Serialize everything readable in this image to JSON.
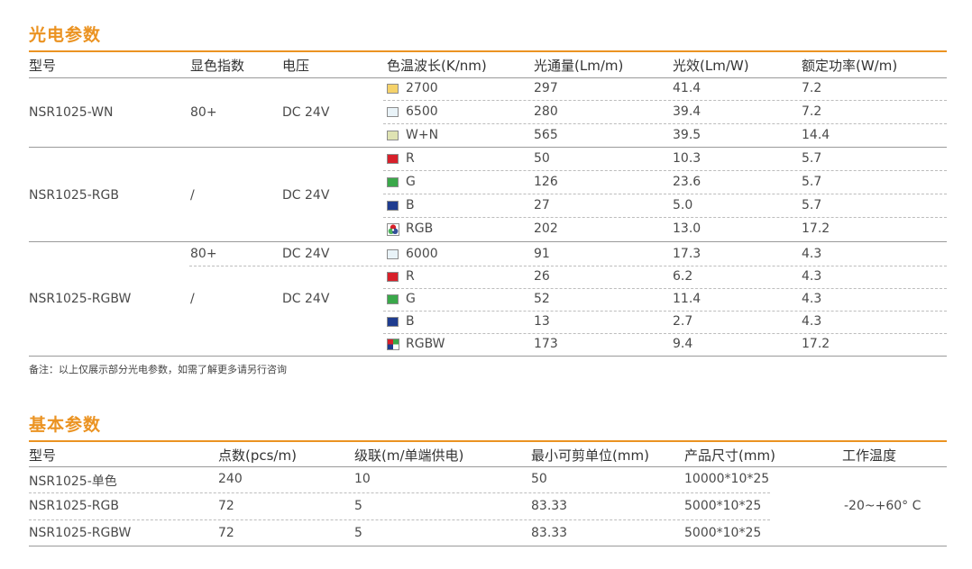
{
  "photo_section": {
    "title": "光电参数",
    "headers": [
      "型号",
      "显色指数",
      "电压",
      "色温波长(K/nm)",
      "光通量(Lm/m)",
      "光效(Lm/W)",
      "额定功率(W/m)"
    ],
    "groups": [
      {
        "model": "NSR1025-WN",
        "cri": "80+",
        "voltage": "DC 24V"
      },
      {
        "model": "NSR1025-RGB",
        "cri": "/",
        "voltage": "DC 24V"
      },
      {
        "model": "NSR1025-RGBW",
        "cri_a": "80+",
        "voltage_a": "DC 24V",
        "cri_b": "/",
        "voltage_b": "DC 24V"
      }
    ],
    "rows": [
      {
        "swatch": "#f5d26a",
        "ct": "2700",
        "flux": "297",
        "eff": "41.4",
        "power": "7.2"
      },
      {
        "swatch": "#e9f3f8",
        "ct": "6500",
        "flux": "280",
        "eff": "39.4",
        "power": "7.2"
      },
      {
        "swatch": "#dfe3b3",
        "ct": "W+N",
        "flux": "565",
        "eff": "39.5",
        "power": "14.4"
      },
      {
        "swatch": "#d7202a",
        "ct": "R",
        "flux": "50",
        "eff": "10.3",
        "power": "5.7"
      },
      {
        "swatch": "#3aa84a",
        "ct": "G",
        "flux": "126",
        "eff": "23.6",
        "power": "5.7"
      },
      {
        "swatch": "#1f3c8f",
        "ct": "B",
        "flux": "27",
        "eff": "5.0",
        "power": "5.7"
      },
      {
        "swatch": "rgb-icon",
        "ct": "RGB",
        "flux": "202",
        "eff": "13.0",
        "power": "17.2"
      },
      {
        "swatch": "#e9f3f8",
        "ct": "6000",
        "flux": "91",
        "eff": "17.3",
        "power": "4.3"
      },
      {
        "swatch": "#d7202a",
        "ct": "R",
        "flux": "26",
        "eff": "6.2",
        "power": "4.3"
      },
      {
        "swatch": "#3aa84a",
        "ct": "G",
        "flux": "52",
        "eff": "11.4",
        "power": "4.3"
      },
      {
        "swatch": "#1f3c8f",
        "ct": "B",
        "flux": "13",
        "eff": "2.7",
        "power": "4.3"
      },
      {
        "swatch": "rgbw-icon",
        "ct": "RGBW",
        "flux": "173",
        "eff": "9.4",
        "power": "17.2"
      }
    ],
    "note": "备注：以上仅展示部分光电参数，如需了解更多请另行咨询"
  },
  "basic_section": {
    "title": "基本参数",
    "headers": [
      "型号",
      "点数(pcs/m)",
      "级联(m/单端供电)",
      "最小可剪单位(mm)",
      "产品尺寸(mm)",
      "工作温度"
    ],
    "rows": [
      {
        "model": "NSR1025-单色",
        "points": "240",
        "cascade": "10",
        "cut": "50",
        "size": "10000*10*25"
      },
      {
        "model": "NSR1025-RGB",
        "points": "72",
        "cascade": "5",
        "cut": "83.33",
        "size": "5000*10*25"
      },
      {
        "model": "NSR1025-RGBW",
        "points": "72",
        "cascade": "5",
        "cut": "83.33",
        "size": "5000*10*25"
      }
    ],
    "temperature": "-20~+60° C"
  },
  "colors": {
    "accent": "#eb9322",
    "text": "#4a4a4a"
  }
}
